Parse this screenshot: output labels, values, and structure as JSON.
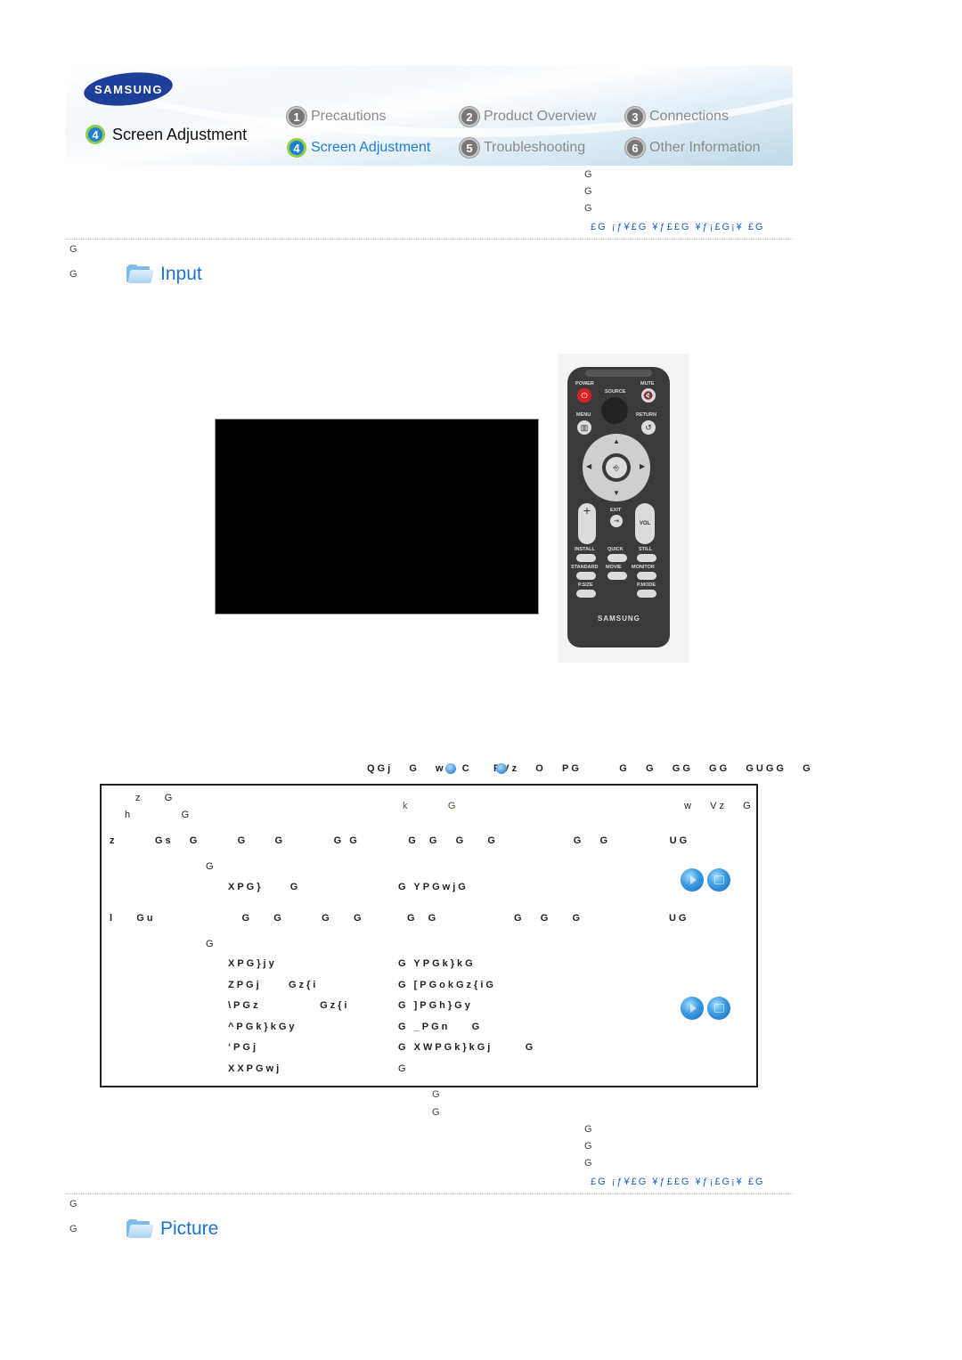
{
  "banner": {
    "brand": "SAMSUNG",
    "current_section": {
      "number": "4",
      "label": "Screen Adjustment"
    },
    "nav": [
      {
        "number": "1",
        "label": "Precautions",
        "active": false
      },
      {
        "number": "2",
        "label": "Product Overview",
        "active": false
      },
      {
        "number": "3",
        "label": "Connections",
        "active": false
      },
      {
        "number": "4",
        "label": "Screen Adjustment",
        "active": true
      },
      {
        "number": "5",
        "label": "Troubleshooting",
        "active": false
      },
      {
        "number": "6",
        "label": "Other Information",
        "active": false
      }
    ]
  },
  "glyph": "G",
  "top_nav_links": "£G ¡ƒ¥£G ¥ƒ££G ¥ƒ¡£G¡¥ £G",
  "sections": {
    "input": {
      "title": "Input",
      "icon": "folder-icon"
    },
    "picture": {
      "title": "Picture",
      "icon": "folder-icon"
    }
  },
  "remote": {
    "brand": "SAMSUNG",
    "labels": [
      "POWER",
      "SOURCE",
      "MUTE",
      "MENU",
      "RETURN",
      "EXIT",
      "VOL",
      "INSTALL",
      "QUICK",
      "STILL",
      "STANDARD",
      "MOVIE",
      "MONITOR",
      "P.SIZE",
      "P.MODE"
    ]
  },
  "instructions": {
    "caption": "QGj   G   w   C    PVz   O   PG       G   G   GG   GG   GUGG   G",
    "box_rows": {
      "r1a": "z    G",
      "r1b": "h         G",
      "r1k": "k       G",
      "r1r": "w   Vz   G",
      "r2": "z       Gs   G       G     G         G G         G  G   G    G              G   G           UG",
      "r3": "G",
      "r4l": "XPG}     G",
      "r4r": "G YPGwjG",
      "r5": "l    Gu                G    G       G    G        G  G              G   G    G                UG",
      "r6": "G"
    },
    "source_list": [
      {
        "left": "XPG}jy",
        "right": "G YPGk}kG"
      },
      {
        "left": "ZPGj     Gz{i",
        "right": "G [PGokGz{iG"
      },
      {
        "left": "\\PGz           Gz{i",
        "right": "G ]PGh}Gy"
      },
      {
        "left": "^PGk}kGy",
        "right": "G _PGn    G"
      },
      {
        "left": "‘PGj",
        "right": "G XWPGk}kGj      G"
      },
      {
        "left": "XXPGwj",
        "right": "G"
      }
    ],
    "media_buttons": [
      "play-button",
      "stop-button"
    ]
  }
}
